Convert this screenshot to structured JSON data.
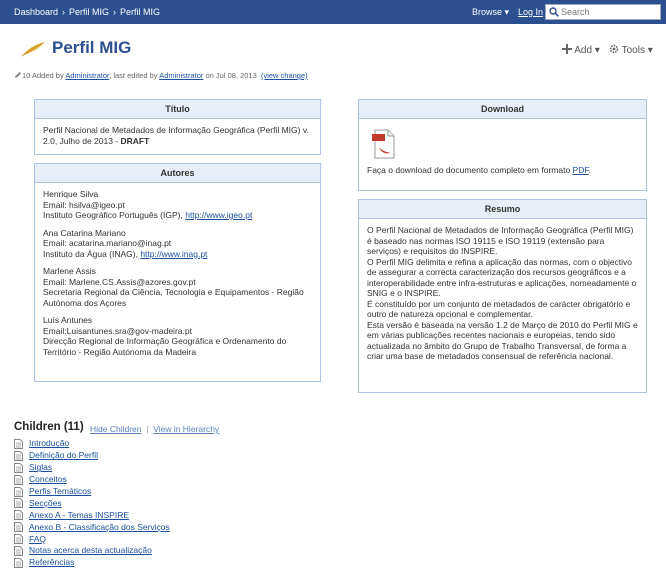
{
  "breadcrumb": [
    "Dashboard",
    "Perfil MIG",
    "Perfil MIG"
  ],
  "nav": {
    "browse": "Browse ▾",
    "login": "Log In",
    "search_placeholder": "Search"
  },
  "page": {
    "title": "Perfil MIG",
    "add_label": "Add ▾",
    "tools_label": "Tools ▾"
  },
  "meta": {
    "prefix": "10 Added by ",
    "author": "Administrator",
    "mid": ", last edited by ",
    "editor": "Administrator",
    "date": " on Jul 08, 2013",
    "view_change": "(view change)"
  },
  "titulo": {
    "header": "Título",
    "text": "Perfil Nacional de Metadados de Informação Geográfica (Perfil MIG) v. 2.0, Julho de 2013 - ",
    "draft": "DRAFT"
  },
  "autores": {
    "header": "Autores",
    "items": [
      {
        "name": "Henrique Silva",
        "email": "Email: hsilva@igeo.pt",
        "org": "Instituto Geográfico Português (IGP), ",
        "url": "http://www.igeo.pt"
      },
      {
        "name": "Ana Catarina Mariano",
        "email": "Email: acatarina.mariano@inag.pt",
        "org": "Instituto da Água (INAG), ",
        "url": "http://www.inag.pt"
      },
      {
        "name": "Marlene Assis",
        "email": "Email: Marlene.CS.Assis@azores.gov.pt",
        "org": "Secretaria Regional da Ciência, Tecnologia e Equipamentos - Região Autónoma dos Açores",
        "url": ""
      },
      {
        "name": "Luís Antunes",
        "email": "Email:Luisantunes.sra@gov-madeira.pt",
        "org": "Direcção Regional de Informação Geográfica e Ordenamento do Território - Região Autónoma da Madeira",
        "url": ""
      }
    ]
  },
  "download": {
    "header": "Download",
    "text": "Faça o download do documento completo em formato ",
    "link": "PDF",
    "end": "."
  },
  "resumo": {
    "header": "Resumo",
    "p1": "O Perfil Nacional de Metadados de Informação Geográfica (Perfil MIG) é baseado nas normas ISO 19115 e ISO 19119 (extensão para serviços) e requisitos do INSPIRE.",
    "p2": "O Perfil MIG delimita e refina a aplicação das normas, com o objectivo de assegurar a correcta caracterização dos recursos geográficos e a interoperabilidade entre infra-estruturas e aplicações, nomeadamente o SNIG e o INSPIRE.",
    "p3": "É constituído por um conjunto de metadados de carácter obrigatório e outro de natureza opcional e complementar.",
    "p4": "Esta versão é baseada na versão 1.2 de Março de 2010 do Perfil MIG e em várias publicações recentes nacionais e europeias, tendo sido actualizada no âmbito do Grupo de Trabalho Transversal, de forma a criar uma base de metadados consensual de referência nacional."
  },
  "children": {
    "title": "Children (11)",
    "hide": "Hide Children",
    "divider": "|",
    "view": "View in Hierarchy",
    "items": [
      "Introdução",
      "Definição do Perfil",
      "Siglas",
      "Conceitos",
      "Perfis Temáticos",
      "Secções",
      "Anexo A - Temas INSPIRE",
      "Anexo B - Classificação dos Serviços",
      "FAQ",
      "Notas acerca desta actualização",
      "Referências"
    ]
  }
}
